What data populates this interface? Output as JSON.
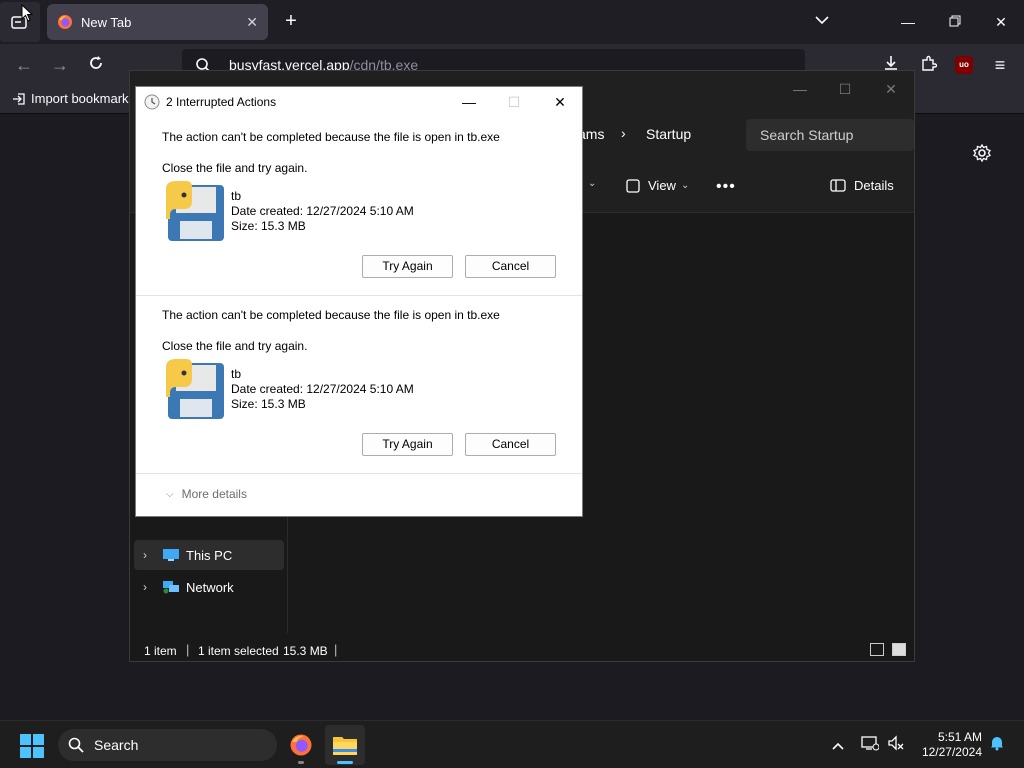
{
  "browser": {
    "tab_title": "New Tab",
    "url_host": "busyfast.vercel.app",
    "url_path": "/cdn/tb.exe",
    "bookmark_label": "Import bookmarks",
    "ext_badge": "uo",
    "accent": "#4cc2ff"
  },
  "explorer": {
    "breadcrumbs": [
      "ams",
      "Startup"
    ],
    "search_placeholder": "Search Startup",
    "toolbar": {
      "view_label": "View",
      "details_label": "Details"
    },
    "nav_items": [
      {
        "label": "This PC",
        "icon": "computer-icon"
      },
      {
        "label": "Network",
        "icon": "network-icon"
      }
    ],
    "status": {
      "count": "1 item",
      "selected": "1 item selected",
      "size": "15.3 MB"
    }
  },
  "dialog": {
    "title": "2 Interrupted Actions",
    "sections": [
      {
        "message": "The action can't be completed because the file is open in tb.exe",
        "instruction": "Close the file and try again.",
        "file_name": "tb",
        "date_created": "Date created: 12/27/2024 5:10 AM",
        "size": "Size: 15.3 MB",
        "try_again_label": "Try Again",
        "cancel_label": "Cancel"
      },
      {
        "message": "The action can't be completed because the file is open in tb.exe",
        "instruction": "Close the file and try again.",
        "file_name": "tb",
        "date_created": "Date created: 12/27/2024 5:10 AM",
        "size": "Size: 15.3 MB",
        "try_again_label": "Try Again",
        "cancel_label": "Cancel"
      }
    ],
    "more_details_label": "More details"
  },
  "taskbar": {
    "search_label": "Search",
    "time": "5:51 AM",
    "date": "12/27/2024"
  }
}
